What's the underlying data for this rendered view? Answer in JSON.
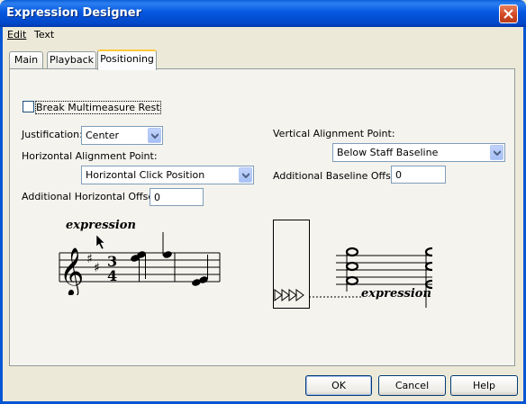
{
  "window": {
    "title": "Expression Designer"
  },
  "menu": {
    "items": [
      "Edit",
      "Text"
    ]
  },
  "tabs": [
    {
      "label": "Main",
      "active": false
    },
    {
      "label": "Playback",
      "active": false
    },
    {
      "label": "Positioning",
      "active": true
    }
  ],
  "positioning": {
    "break_multimeasure_rest": {
      "label": "Break Multimeasure Rest",
      "checked": false
    },
    "justification": {
      "label": "Justification:",
      "value": "Center"
    },
    "horizontal_alignment_point": {
      "label": "Horizontal Alignment Point:",
      "value": "Horizontal Click Position"
    },
    "additional_horizontal_offset": {
      "label": "Additional Horizontal Offset:",
      "value": "0"
    },
    "vertical_alignment_point": {
      "label": "Vertical Alignment Point:",
      "value": "Below Staff Baseline"
    },
    "additional_baseline_offset": {
      "label": "Additional Baseline Offset:",
      "value": "0"
    },
    "preview_left": {
      "text": "expression",
      "time_signature": [
        "3",
        "4"
      ]
    },
    "preview_right": {
      "text": "expression"
    }
  },
  "buttons": {
    "ok": "OK",
    "cancel": "Cancel",
    "help": "Help"
  },
  "colors": {
    "titlebar": "#0558e0",
    "dialog": "#ece9d8",
    "panel": "#f4f3ee",
    "active_tab_accent": "#ffc83c"
  }
}
